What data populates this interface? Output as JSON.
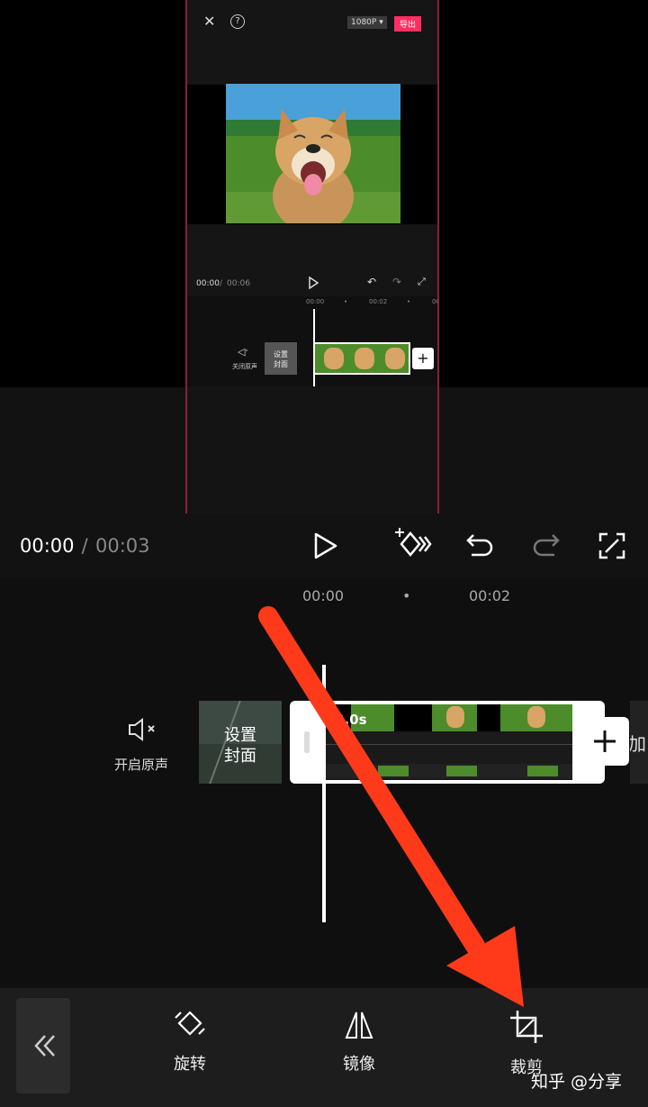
{
  "embedded": {
    "resolution": "1080P ▾",
    "export": "导出",
    "time_current": "00:00",
    "time_sep": " / ",
    "time_total": "00:06",
    "ruler": [
      "00:00",
      "•",
      "00:02",
      "•",
      "00:0"
    ],
    "mute_label": "关闭原声",
    "cover_line1": "设置",
    "cover_line2": "封面"
  },
  "player": {
    "time_current": "00:00",
    "time_sep": " / ",
    "time_total": "00:03"
  },
  "timeline": {
    "ruler": [
      "00:00",
      "•",
      "00:02"
    ],
    "mute_label": "开启原声",
    "cover_line1": "设置",
    "cover_line2": "封面",
    "clip_duration": "3.0s",
    "add_label": "加"
  },
  "toolbar": {
    "items": [
      {
        "label": "旋转",
        "icon": "rotate-icon"
      },
      {
        "label": "镜像",
        "icon": "mirror-icon"
      },
      {
        "label": "裁剪",
        "icon": "crop-icon"
      }
    ]
  },
  "watermark": "知乎 @分享",
  "colors": {
    "export_button": "#ff2e62",
    "arrow": "#ff3a1a",
    "frame_border": "#8a2036"
  }
}
